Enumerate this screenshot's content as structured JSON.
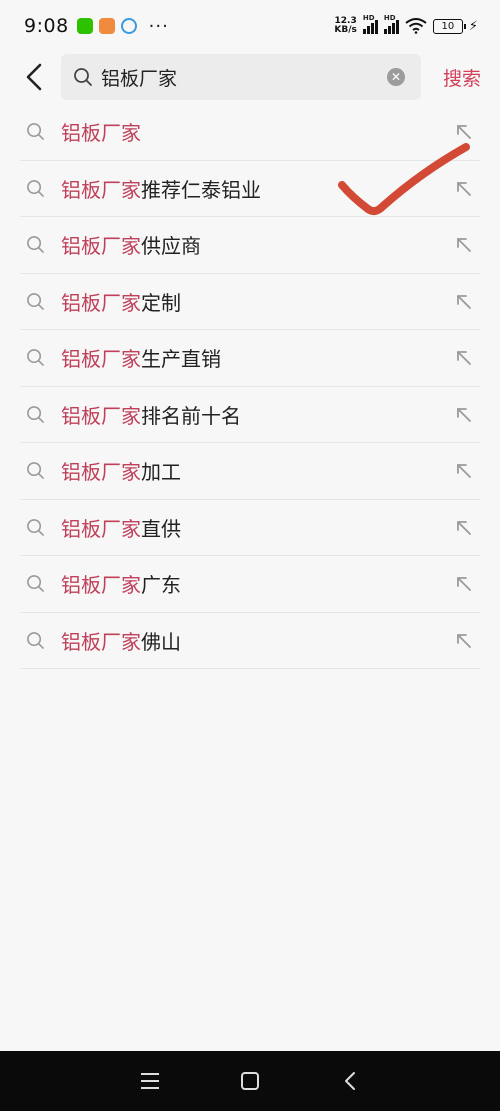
{
  "status_bar": {
    "time": "9:08",
    "net_speed_value": "12.3",
    "net_speed_unit": "KB/s",
    "hd_label": "HD",
    "battery": "10"
  },
  "search": {
    "query": "铝板厂家",
    "submit_label": "搜索"
  },
  "suggestions": [
    {
      "highlight": "铝板厂家",
      "rest": ""
    },
    {
      "highlight": "铝板厂家",
      "rest": "推荐仁泰铝业"
    },
    {
      "highlight": "铝板厂家",
      "rest": "供应商"
    },
    {
      "highlight": "铝板厂家",
      "rest": "定制"
    },
    {
      "highlight": "铝板厂家",
      "rest": "生产直销"
    },
    {
      "highlight": "铝板厂家",
      "rest": "排名前十名"
    },
    {
      "highlight": "铝板厂家",
      "rest": "加工"
    },
    {
      "highlight": "铝板厂家",
      "rest": "直供"
    },
    {
      "highlight": "铝板厂家",
      "rest": "广东"
    },
    {
      "highlight": "铝板厂家",
      "rest": "佛山"
    }
  ],
  "colors": {
    "accent": "#d2405a",
    "highlight": "#c0405a",
    "check_mark": "#d24a35"
  }
}
